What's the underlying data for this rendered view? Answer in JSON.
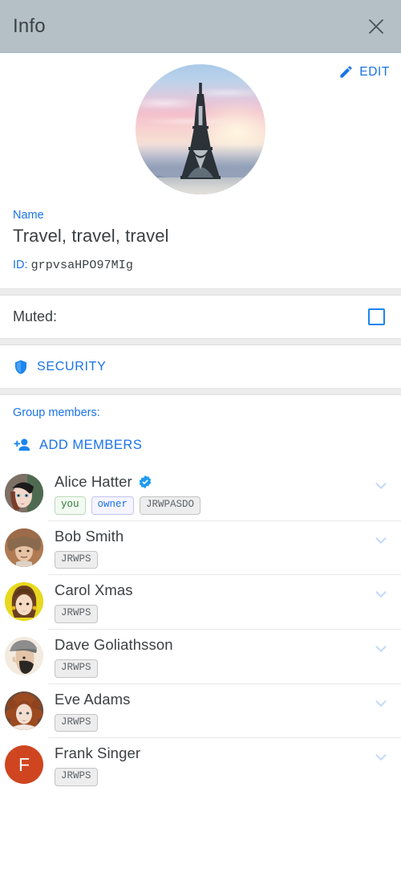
{
  "header": {
    "title": "Info",
    "close_icon": "close-icon"
  },
  "profile": {
    "edit_label": "EDIT",
    "edit_icon": "pencil-icon",
    "avatar_icon": "group-avatar-eiffel-tower",
    "name_label": "Name",
    "group_name": "Travel, travel, travel",
    "id_label": "ID:",
    "id_value": "grpvsaHPO97MIg"
  },
  "muted": {
    "label": "Muted:",
    "checked": false
  },
  "security": {
    "label": "SECURITY",
    "icon": "shield-icon"
  },
  "members_section": {
    "label": "Group members:",
    "add_label": "ADD MEMBERS",
    "add_icon": "person-add-icon"
  },
  "members": [
    {
      "name": "Alice Hatter",
      "verified": true,
      "avatar_type": "photo",
      "avatar_initial": "A",
      "avatar_color": "#6b5b54",
      "tags": [
        {
          "text": "you",
          "style": "you"
        },
        {
          "text": "owner",
          "style": "owner"
        },
        {
          "text": "JRWPASDO",
          "style": "code"
        }
      ]
    },
    {
      "name": "Bob Smith",
      "verified": false,
      "avatar_type": "photo",
      "avatar_initial": "B",
      "avatar_color": "#a96a4a",
      "tags": [
        {
          "text": "JRWPS",
          "style": "code"
        }
      ]
    },
    {
      "name": "Carol Xmas",
      "verified": false,
      "avatar_type": "photo",
      "avatar_initial": "C",
      "avatar_color": "#e4d321",
      "tags": [
        {
          "text": "JRWPS",
          "style": "code"
        }
      ]
    },
    {
      "name": "Dave Goliathsson",
      "verified": false,
      "avatar_type": "photo",
      "avatar_initial": "D",
      "avatar_color": "#efe6da",
      "tags": [
        {
          "text": "JRWPS",
          "style": "code"
        }
      ]
    },
    {
      "name": "Eve Adams",
      "verified": false,
      "avatar_type": "photo",
      "avatar_initial": "E",
      "avatar_color": "#8c5a42",
      "tags": [
        {
          "text": "JRWPS",
          "style": "code"
        }
      ]
    },
    {
      "name": "Frank Singer",
      "verified": false,
      "avatar_type": "initial",
      "avatar_initial": "F",
      "avatar_color": "#cf4520",
      "tags": [
        {
          "text": "JRWPS",
          "style": "code"
        }
      ]
    }
  ],
  "colors": {
    "header_bg": "#b4c0c6",
    "accent_blue": "#1a73e8",
    "chevron_blue": "#c3dafc",
    "divider": "#ececec"
  }
}
